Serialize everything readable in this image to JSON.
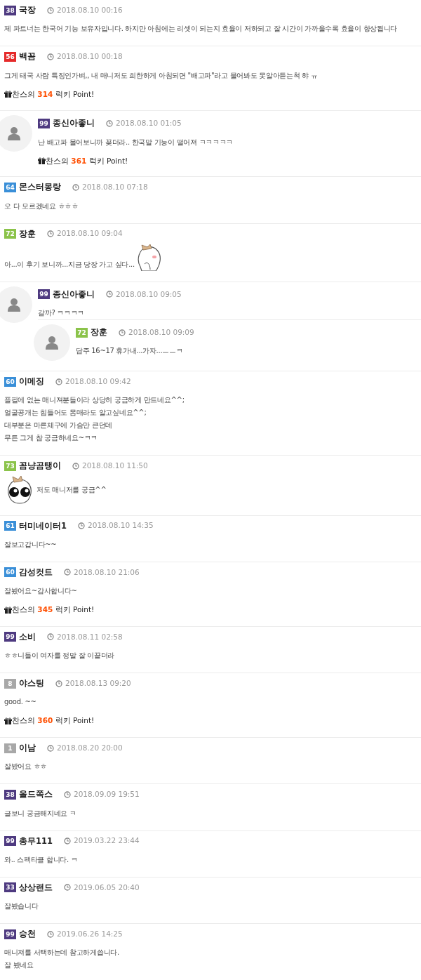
{
  "comments": [
    {
      "level": "38",
      "color": "#4e3a80",
      "name": "국장",
      "time": "2018.08.10 00:16",
      "lines": [
        "제 파트너는 한국어 기능 보유자입니다. 하지만 아침에는 리셋이 되는지 효율이 저하되고 잘 시간이 가까울수록 효율이 향상됩니다"
      ]
    },
    {
      "level": "56",
      "color": "#e52a2a",
      "name": "백꼼",
      "time": "2018.08.10 00:18",
      "lines": [
        "그게 태국 사람 특징인가벼,, 내 매니저도 희한하게 아침되면 \"배고파\"라고 물어봐도 못알아듣는척 햐 ㅠ"
      ],
      "point": {
        "before": "찬스의",
        "value": "314",
        "after": "럭키 Point!"
      },
      "replies": [
        {
          "level": "99",
          "color": "#4e3a80",
          "name": "종신아좋니",
          "time": "2018.08.10 01:05",
          "lines": [
            "난 배고파 물어보니까 꽂더라.. 한국말 기능이 떨어져 ㅋㅋㅋㅋㅋ"
          ],
          "point": {
            "before": "찬스의",
            "value": "361",
            "after": "럭키 Point!"
          }
        }
      ]
    },
    {
      "level": "64",
      "color": "#3a8fd8",
      "name": "몬스터몽랑",
      "time": "2018.08.10 07:18",
      "lines": [
        "오 다 모르겠네요 ㅎㅎㅎ"
      ]
    },
    {
      "level": "72",
      "color": "#8bc34a",
      "name": "장훈",
      "time": "2018.08.10 09:04",
      "lines": [
        "아...이 후기 보니까...지금 당장 가고 싶다..."
      ],
      "sticker": true,
      "sticker_first": false,
      "replies": [
        {
          "level": "99",
          "color": "#4e3a80",
          "name": "종신아좋니",
          "time": "2018.08.10 09:05",
          "lines": [
            "갈까? ㅋㅋㅋㅋ"
          ],
          "replies": [
            {
              "level": "72",
              "color": "#8bc34a",
              "name": "장훈",
              "time": "2018.08.10 09:09",
              "lines": [
                "담주 16~17 휴가내...가자...ㅡㅡㅋ"
              ]
            }
          ]
        }
      ]
    },
    {
      "level": "60",
      "color": "#3a8fd8",
      "name": "이메징",
      "time": "2018.08.10 09:42",
      "lines": [
        "플필에 없는 매니져분들이라 상당히 궁금하게 만드네요^^;",
        "얼굴공개는 힘들어도 몸매라도 알고싶네요^^;",
        "대부분은 마른체구에 가슴만 큰던데",
        "무튼 그게 참 궁금하네요~ㅋㅋ"
      ]
    },
    {
      "level": "73",
      "color": "#8bc34a",
      "name": "꼼냥곰탱이",
      "time": "2018.08.10 11:50",
      "lines": [
        "저도 매니저를 궁금^^"
      ],
      "sticker": true,
      "sticker_first": true
    },
    {
      "level": "61",
      "color": "#3a8fd8",
      "name": "터미네이터1",
      "time": "2018.08.10 14:35",
      "lines": [
        "잘보고갑니다~~"
      ]
    },
    {
      "level": "60",
      "color": "#3a8fd8",
      "name": "감성컷트",
      "time": "2018.08.10 21:06",
      "lines": [
        "잘봤어요~감사합니다~"
      ],
      "point": {
        "before": "찬스의",
        "value": "345",
        "after": "럭키 Point!"
      }
    },
    {
      "level": "99",
      "color": "#4e3a80",
      "name": "소비",
      "time": "2018.08.11 02:58",
      "lines": [
        "ㅎㅎ니들이 여자를 정말 잘 이끝더라"
      ]
    },
    {
      "level": "8",
      "color": "#a8a8a8",
      "name": "야스팅",
      "time": "2018.08.13 09:20",
      "lines": [
        "good.   ~~"
      ],
      "point": {
        "before": "찬스의",
        "value": "360",
        "after": "럭키 Point!"
      }
    },
    {
      "level": "1",
      "color": "#a8a8a8",
      "name": "이남",
      "time": "2018.08.20 20:00",
      "lines": [
        "잘봤어요 ㅎㅎ"
      ]
    },
    {
      "level": "38",
      "color": "#4e3a80",
      "name": "올드쪽스",
      "time": "2018.09.09 19:51",
      "lines": [
        "글보니 궁금해지네요 ㅋ"
      ]
    },
    {
      "level": "99",
      "color": "#4e3a80",
      "name": "총무111",
      "time": "2019.03.22 23:44",
      "lines": [
        "와.. 스팩타클 합니다. ㅋ"
      ]
    },
    {
      "level": "33",
      "color": "#4e3a80",
      "name": "상상랜드",
      "time": "2019.06.05 20:40",
      "lines": [
        "잘봤습니다"
      ]
    },
    {
      "level": "99",
      "color": "#4e3a80",
      "name": "승천",
      "time": "2019.06.26 14:25",
      "lines": [
        "매니져를 서택하는데 참고하게씁니다.",
        "잘 봤네요"
      ]
    }
  ]
}
